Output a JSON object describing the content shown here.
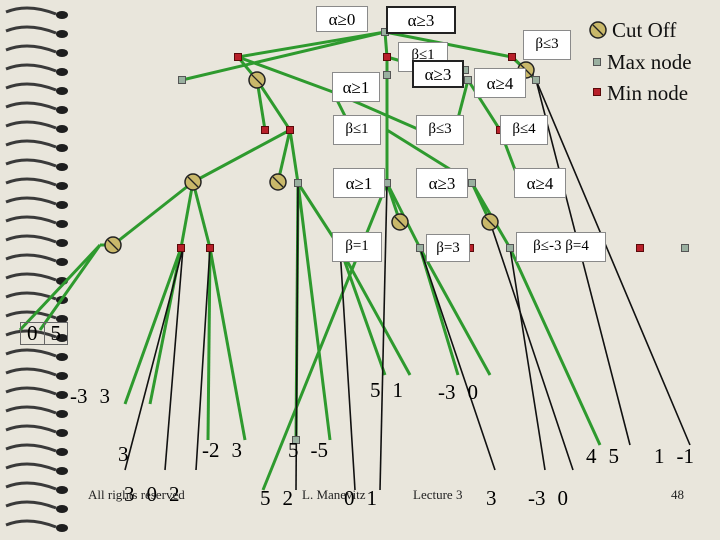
{
  "legend": {
    "cut_off": "Cut Off",
    "max_node": "Max node",
    "min_node": "Min node"
  },
  "colors": {
    "edge": "#2e9a2e",
    "max_node": "#9ab0a0",
    "min_node": "#b8202a",
    "cut_icon": "#c9b86a",
    "background": "#e9e6dc"
  },
  "labels": {
    "alpha_ge_0": "α≥0",
    "alpha_ge_3_top": "α≥3",
    "beta_le_3_top": "β≤3",
    "beta_le_1_top": "β≤1",
    "alpha_ge_3_mid": "α≥3",
    "alpha_ge_4": "α≥4",
    "alpha_ge_1": "α≥1",
    "beta_le_1": "β≤1",
    "beta_le_3": "β≤3",
    "beta_le_4": "β≤4",
    "alpha_ge_1_b": "α≥1",
    "alpha_ge_3_b": "α≥3",
    "alpha_ge_4_b": "α≥4",
    "beta_eq_1": "β=1",
    "beta_eq_3": "β=3",
    "beta_le_m3_eq_4": "β≤-3  β=4"
  },
  "leaves": {
    "l_0_5": [
      "0",
      "5"
    ],
    "l_m3_3": [
      "-3",
      "3"
    ],
    "l_5_1": [
      "5",
      "1"
    ],
    "l_m3_0_mid": [
      "-3",
      "0"
    ],
    "l_3": [
      "3"
    ],
    "l_m2_3": [
      "-2",
      "3"
    ],
    "l_5_m5": [
      "5",
      "-5"
    ],
    "l_4_5": [
      "4",
      "5"
    ],
    "l_1_m1": [
      "1",
      "-1"
    ],
    "l_3_0_2": [
      "3",
      "0",
      "2"
    ],
    "l_5_2": [
      "5",
      "2"
    ],
    "l_0_1": [
      "0",
      "1"
    ],
    "l_3_b": [
      "3"
    ],
    "l_m3_0_b": [
      "-3",
      "0"
    ]
  },
  "footer": {
    "rights": "All rights reserved",
    "author": "L. Manevitz",
    "lecture": "Lecture 3",
    "page": "48"
  }
}
